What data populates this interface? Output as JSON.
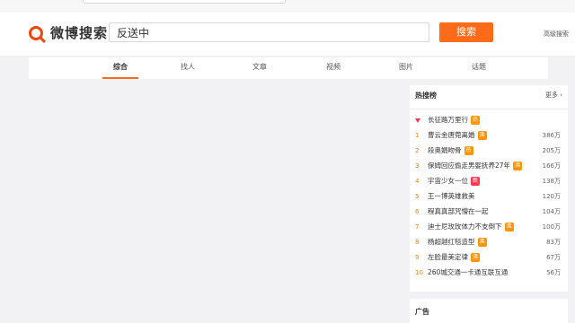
{
  "search": {
    "logo_text": "微博搜索",
    "query": "反送中",
    "button_label": "搜索",
    "advanced_label": "高级搜索"
  },
  "tabs": [
    {
      "label": "综合",
      "active": true
    },
    {
      "label": "找人",
      "active": false
    },
    {
      "label": "文章",
      "active": false
    },
    {
      "label": "视频",
      "active": false
    },
    {
      "label": "图片",
      "active": false
    },
    {
      "label": "话题",
      "active": false
    }
  ],
  "hot_search": {
    "title": "热搜榜",
    "more_label": "更多 ›",
    "pinned": {
      "title": "长征路万里行",
      "badge": "热"
    },
    "items": [
      {
        "rank": "1",
        "title": "曹云金唐菀离婚",
        "badge": "沸",
        "count": "386万"
      },
      {
        "rank": "2",
        "title": "段奥娟吻骨",
        "badge": "热",
        "count": "205万"
      },
      {
        "rank": "3",
        "title": "保姆回应偷走男婴抚养27年",
        "badge": "沸",
        "count": "166万"
      },
      {
        "rank": "4",
        "title": "宇宙少女一位",
        "badge": "新",
        "count": "138万"
      },
      {
        "rank": "5",
        "title": "王一博英雄救美",
        "badge": "",
        "count": "120万"
      },
      {
        "rank": "6",
        "title": "程真真部咒懵在一起",
        "badge": "",
        "count": "104万"
      },
      {
        "rank": "7",
        "title": "迪士尼玫玫体力不支倒下",
        "badge": "沸",
        "count": "100万"
      },
      {
        "rank": "8",
        "title": "杨超越红毯造型",
        "badge": "沸",
        "count": "83万"
      },
      {
        "rank": "9",
        "title": "左脸最美定律",
        "badge": "沸",
        "count": "67万"
      },
      {
        "rank": "10",
        "title": "260城交通一卡通互联互通",
        "badge": "",
        "count": "56万"
      }
    ]
  },
  "ad": {
    "label": "广告"
  },
  "colors": {
    "accent": "#ff6b19",
    "hot_badge": "#ff9406",
    "new_badge": "#ff3852"
  }
}
